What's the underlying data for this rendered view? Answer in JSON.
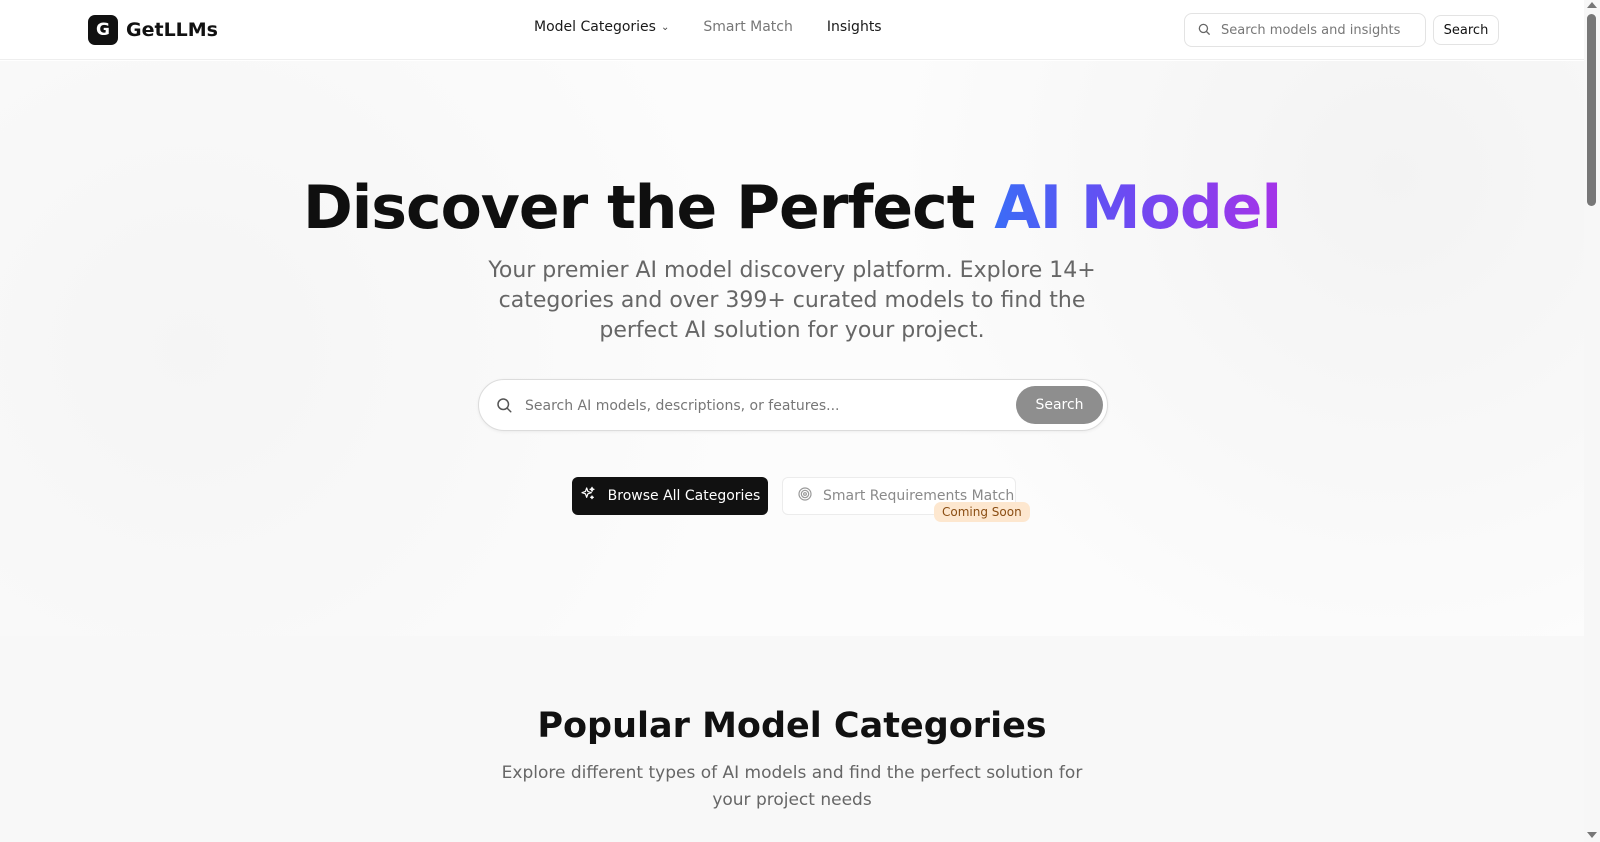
{
  "header": {
    "logo_letter": "G",
    "brand": "GetLLMs",
    "nav": [
      {
        "label": "Model Categories",
        "has_dropdown": true
      },
      {
        "label": "Smart Match"
      },
      {
        "label": "Insights"
      }
    ],
    "search_placeholder": "Search models and insights",
    "search_button": "Search"
  },
  "hero": {
    "title_plain": "Discover the Perfect ",
    "title_highlight": "AI Model",
    "subtitle": "Your premier AI model discovery platform. Explore 14+ categories and over 399+ curated models to find the perfect AI solution for your project.",
    "search_placeholder": "Search AI models, descriptions, or features...",
    "search_button": "Search",
    "browse_button": "Browse All Categories",
    "smart_button": "Smart Requirements Match",
    "smart_badge": "Coming Soon"
  },
  "popular": {
    "title": "Popular Model Categories",
    "subtitle": "Explore different types of AI models and find the perfect solution for your project needs"
  },
  "colors": {
    "accent_gradient_start": "#3b6cf6",
    "accent_gradient_end": "#a533e8",
    "primary_button": "#111111",
    "badge_bg": "#fde7cf"
  },
  "icons": {
    "search": "search-icon",
    "sparkle": "sparkle-icon",
    "target": "target-icon",
    "chevron": "chevron-down-icon"
  }
}
